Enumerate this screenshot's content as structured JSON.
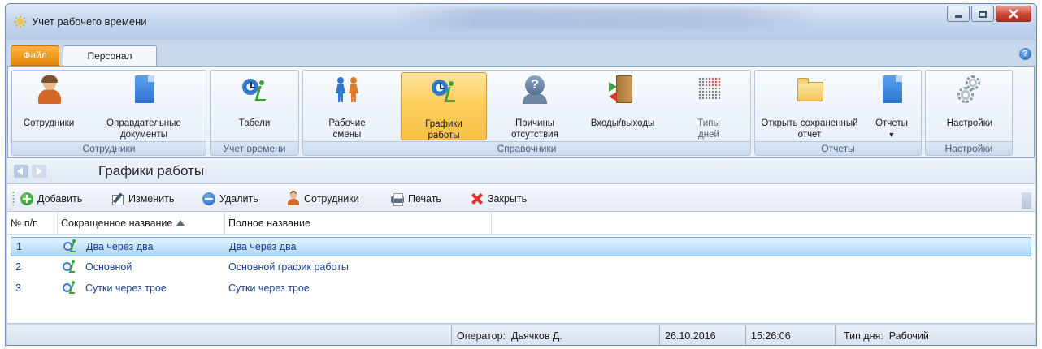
{
  "window": {
    "title": "Учет рабочего времени"
  },
  "ribbon": {
    "tabs": [
      {
        "label": "Файл"
      },
      {
        "label": "Персонал"
      }
    ],
    "groups": [
      {
        "label": "Сотрудники",
        "buttons": [
          {
            "label": "Сотрудники"
          },
          {
            "label": "Оправдательные документы"
          }
        ]
      },
      {
        "label": "Учет времени",
        "buttons": [
          {
            "label": "Табели"
          }
        ]
      },
      {
        "label": "Справочники",
        "buttons": [
          {
            "label": "Рабочие смены"
          },
          {
            "label": "Графики работы"
          },
          {
            "label": "Причины отсутствия"
          },
          {
            "label": "Входы/выходы"
          },
          {
            "label": "Типы дней"
          }
        ]
      },
      {
        "label": "Отчеты",
        "buttons": [
          {
            "label": "Открыть сохраненный отчет"
          },
          {
            "label": "Отчеты"
          }
        ]
      },
      {
        "label": "Настройки",
        "buttons": [
          {
            "label": "Настройки"
          }
        ]
      }
    ]
  },
  "page": {
    "title": "Графики работы"
  },
  "toolbar": {
    "add": "Добавить",
    "edit": "Изменить",
    "delete": "Удалить",
    "employees": "Сотрудники",
    "print": "Печать",
    "close": "Закрыть"
  },
  "grid": {
    "columns": [
      "№ п/п",
      "Сокращенное название",
      "Полное название"
    ],
    "rows": [
      {
        "num": "1",
        "short": "Два через два",
        "full": "Два через два",
        "selected": true
      },
      {
        "num": "2",
        "short": "Основной",
        "full": "Основной график работы",
        "selected": false
      },
      {
        "num": "3",
        "short": "Сутки через трое",
        "full": "Сутки через трое",
        "selected": false
      }
    ]
  },
  "status": {
    "operator_label": "Оператор:",
    "operator_name": "Дьячков Д.",
    "date": "26.10.2016",
    "time": "15:26:06",
    "day_type_label": "Тип дня:",
    "day_type": "Рабочий"
  },
  "colors": {
    "accent_file_tab": "#e7880b",
    "active_button": "#fbcf5d",
    "selected_row": "#c4e3fa",
    "row_text": "#1a3f8f"
  }
}
